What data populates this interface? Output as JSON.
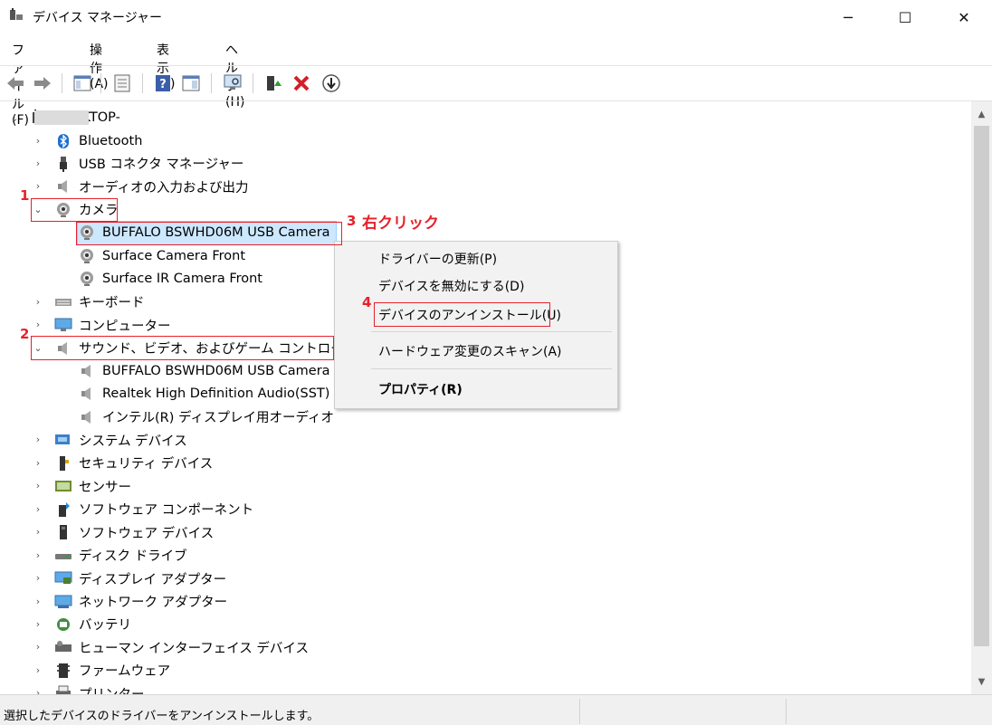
{
  "window": {
    "title": "デバイス マネージャー",
    "minimize_glyph": "─",
    "maximize_glyph": "☐",
    "close_glyph": "✕"
  },
  "menu": [
    "ファイル(F)",
    "操作(A)",
    "表示(V)",
    "ヘルプ(H)"
  ],
  "toolbar_icons": [
    "back-icon",
    "forward-icon",
    "show-hide-tree-icon",
    "properties-icon",
    "help-icon",
    "view-icon",
    "scan-hardware-icon",
    "update-driver-icon",
    "uninstall-icon",
    "install-icon"
  ],
  "tree": {
    "root": "DESKTOP-",
    "items": [
      {
        "label": "Bluetooth",
        "icon": "bluetooth-icon",
        "expanded": false
      },
      {
        "label": "USB コネクタ マネージャー",
        "icon": "usb-connector-icon",
        "expanded": false
      },
      {
        "label": "オーディオの入力および出力",
        "icon": "speaker-icon",
        "expanded": false
      },
      {
        "label": "カメラ",
        "icon": "camera-icon",
        "expanded": true,
        "children": [
          {
            "label": "BUFFALO BSWHD06M USB Camera",
            "icon": "camera-icon",
            "selected": true
          },
          {
            "label": "Surface Camera Front",
            "icon": "camera-icon"
          },
          {
            "label": "Surface IR Camera Front",
            "icon": "camera-icon"
          }
        ]
      },
      {
        "label": "キーボード",
        "icon": "keyboard-icon",
        "expanded": false
      },
      {
        "label": "コンピューター",
        "icon": "monitor-icon",
        "expanded": false
      },
      {
        "label": "サウンド、ビデオ、およびゲーム コントローラー",
        "icon": "speaker-icon",
        "expanded": true,
        "children": [
          {
            "label": "BUFFALO BSWHD06M USB Camera",
            "icon": "speaker-icon"
          },
          {
            "label": "Realtek High Definition Audio(SST)",
            "icon": "speaker-icon"
          },
          {
            "label": "インテル(R) ディスプレイ用オーディオ",
            "icon": "speaker-icon"
          }
        ]
      },
      {
        "label": "システム デバイス",
        "icon": "system-device-icon",
        "expanded": false
      },
      {
        "label": "セキュリティ デバイス",
        "icon": "security-device-icon",
        "expanded": false
      },
      {
        "label": "センサー",
        "icon": "sensor-icon",
        "expanded": false
      },
      {
        "label": "ソフトウェア コンポーネント",
        "icon": "software-component-icon",
        "expanded": false
      },
      {
        "label": "ソフトウェア デバイス",
        "icon": "software-device-icon",
        "expanded": false
      },
      {
        "label": "ディスク ドライブ",
        "icon": "disk-drive-icon",
        "expanded": false
      },
      {
        "label": "ディスプレイ アダプター",
        "icon": "display-adapter-icon",
        "expanded": false
      },
      {
        "label": "ネットワーク アダプター",
        "icon": "network-adapter-icon",
        "expanded": false
      },
      {
        "label": "バッテリ",
        "icon": "battery-icon",
        "expanded": false
      },
      {
        "label": "ヒューマン インターフェイス デバイス",
        "icon": "hid-icon",
        "expanded": false
      },
      {
        "label": "ファームウェア",
        "icon": "firmware-icon",
        "expanded": false
      },
      {
        "label": "プリンター",
        "icon": "printer-icon",
        "expanded": false
      }
    ]
  },
  "context_menu": {
    "update_driver": "ドライバーの更新(P)",
    "disable_device": "デバイスを無効にする(D)",
    "uninstall_device": "デバイスのアンインストール(U)",
    "scan_hardware": "ハードウェア変更のスキャン(A)",
    "properties": "プロパティ(R)"
  },
  "annotations": {
    "step1": "1",
    "step2": "2",
    "step3": "3",
    "step3_text": "右クリック",
    "step4": "4"
  },
  "status": {
    "text": "選択したデバイスのドライバーをアンインストールします。"
  },
  "colors": {
    "annotation": "#e8202a",
    "selection": "#cce8ff"
  }
}
